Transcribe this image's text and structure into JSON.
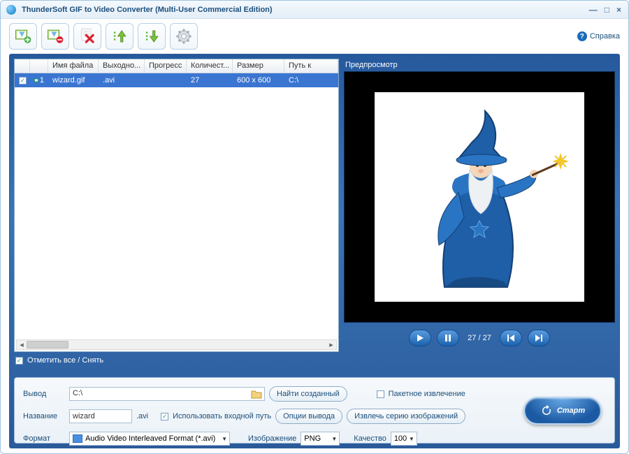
{
  "window": {
    "title": "ThunderSoft GIF to Video Converter (Multi-User Commercial Edition)"
  },
  "help": {
    "label": "Справка"
  },
  "toolbar": {
    "buttons": [
      "add-file",
      "remove-file",
      "clear-list",
      "move-up",
      "move-down",
      "settings"
    ]
  },
  "table": {
    "headers": {
      "check": "",
      "num": "",
      "filename": "Имя файла",
      "output": "Выходно...",
      "progress": "Прогресс",
      "count": "Количест...",
      "size": "Размер",
      "path": "Путь к"
    },
    "rows": [
      {
        "checked": true,
        "num": "1",
        "filename": "wizard.gif",
        "output": ".avi",
        "progress": "",
        "count": "27",
        "size": "600 x 600",
        "path": "C:\\"
      }
    ],
    "check_all_label": "Отметить все / Снять",
    "check_all_checked": true
  },
  "preview": {
    "label": "Предпросмотр",
    "frame_current": "27",
    "frame_total": "27"
  },
  "output": {
    "label": "Вывод",
    "path": "C:\\",
    "find_created": "Найти созданный",
    "batch_extract_label": "Пакетное извлечение",
    "batch_extract_checked": false
  },
  "name": {
    "label": "Название",
    "value": "wizard",
    "ext": ".avi",
    "use_input_path_label": "Использовать входной путь",
    "use_input_path_checked": true,
    "output_options": "Опции вывода",
    "extract_series": "Извлечь серию изображений"
  },
  "format": {
    "label": "Формат",
    "value": "Audio Video Interleaved Format (*.avi)",
    "image_label": "Изображение",
    "image_value": "PNG",
    "quality_label": "Качество",
    "quality_value": "100"
  },
  "start_label": "Старт"
}
